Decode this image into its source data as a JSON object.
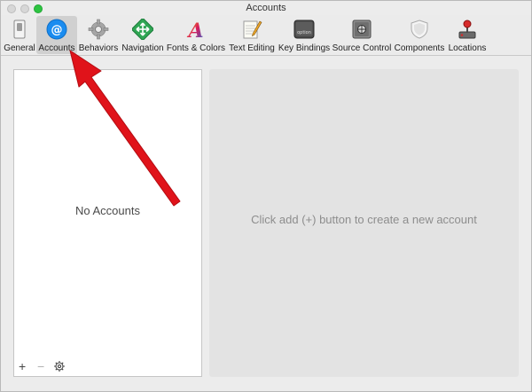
{
  "window": {
    "title": "Accounts"
  },
  "toolbar": {
    "items": [
      {
        "id": "general",
        "label": "General",
        "icon": "switch-icon"
      },
      {
        "id": "accounts",
        "label": "Accounts",
        "icon": "at-sign-icon",
        "selected": true
      },
      {
        "id": "behaviors",
        "label": "Behaviors",
        "icon": "gear-icon"
      },
      {
        "id": "navigation",
        "label": "Navigation",
        "icon": "navigation-arrows-icon"
      },
      {
        "id": "fonts-colors",
        "label": "Fonts & Colors",
        "icon": "font-a-icon"
      },
      {
        "id": "text-editing",
        "label": "Text Editing",
        "icon": "pencil-paper-icon"
      },
      {
        "id": "key-bindings",
        "label": "Key Bindings",
        "icon": "option-key-icon"
      },
      {
        "id": "source-control",
        "label": "Source Control",
        "icon": "safe-icon"
      },
      {
        "id": "components",
        "label": "Components",
        "icon": "shield-icon"
      },
      {
        "id": "locations",
        "label": "Locations",
        "icon": "joystick-icon"
      }
    ]
  },
  "accounts_list": {
    "empty_text": "No Accounts",
    "add_label": "+",
    "remove_label": "−"
  },
  "detail": {
    "hint": "Click add (+) button to create a new account"
  },
  "colors": {
    "accent": "#1a8cf0",
    "annotation_arrow": "#e0131a",
    "selected_tab": "#d0d0d0"
  }
}
